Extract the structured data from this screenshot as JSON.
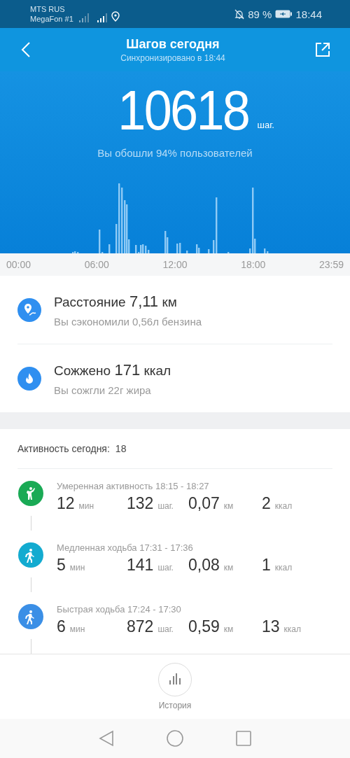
{
  "status_bar": {
    "carrier_1": "MTS RUS",
    "carrier_2": "MegaFon #1",
    "battery": "89 %",
    "time": "18:44"
  },
  "header": {
    "title": "Шагов сегодня",
    "subtitle": "Синхронизировано в 18:44"
  },
  "summary": {
    "steps": "10618",
    "steps_unit": "шаг.",
    "comparison": "Вы обошли 94% пользователей"
  },
  "time_axis": [
    "00:00",
    "06:00",
    "12:00",
    "18:00",
    "23:59"
  ],
  "stats": [
    {
      "kind": "distance",
      "label": "Расстояние",
      "value": "7,11",
      "unit": "км",
      "note": "Вы сэкономили 0,56л бензина"
    },
    {
      "kind": "calories",
      "label": "Сожжено",
      "value": "171",
      "unit": "ккал",
      "note": "Вы сожгли 22г жира"
    }
  ],
  "activity": {
    "label": "Активность сегодня:",
    "count": "18",
    "items": [
      {
        "kind": "stretch",
        "color": "#1aaa55",
        "title": "Умеренная активность 18:15 - 18:27",
        "stats": [
          {
            "value": "12",
            "unit": "мин"
          },
          {
            "value": "132",
            "unit": "шаг."
          },
          {
            "value": "0,07",
            "unit": "км"
          },
          {
            "value": "2",
            "unit": "ккал"
          }
        ]
      },
      {
        "kind": "walk",
        "color": "#13abd0",
        "title": "Медленная ходьба 17:31 - 17:36",
        "stats": [
          {
            "value": "5",
            "unit": "мин"
          },
          {
            "value": "141",
            "unit": "шаг."
          },
          {
            "value": "0,08",
            "unit": "км"
          },
          {
            "value": "1",
            "unit": "ккал"
          }
        ]
      },
      {
        "kind": "walk",
        "color": "#3b8fe6",
        "title": "Быстрая ходьба 17:24 - 17:30",
        "stats": [
          {
            "value": "6",
            "unit": "мин"
          },
          {
            "value": "872",
            "unit": "шаг."
          },
          {
            "value": "0,59",
            "unit": "км"
          },
          {
            "value": "13",
            "unit": "ккал"
          }
        ]
      }
    ]
  },
  "bottom": {
    "history_label": "История"
  }
}
